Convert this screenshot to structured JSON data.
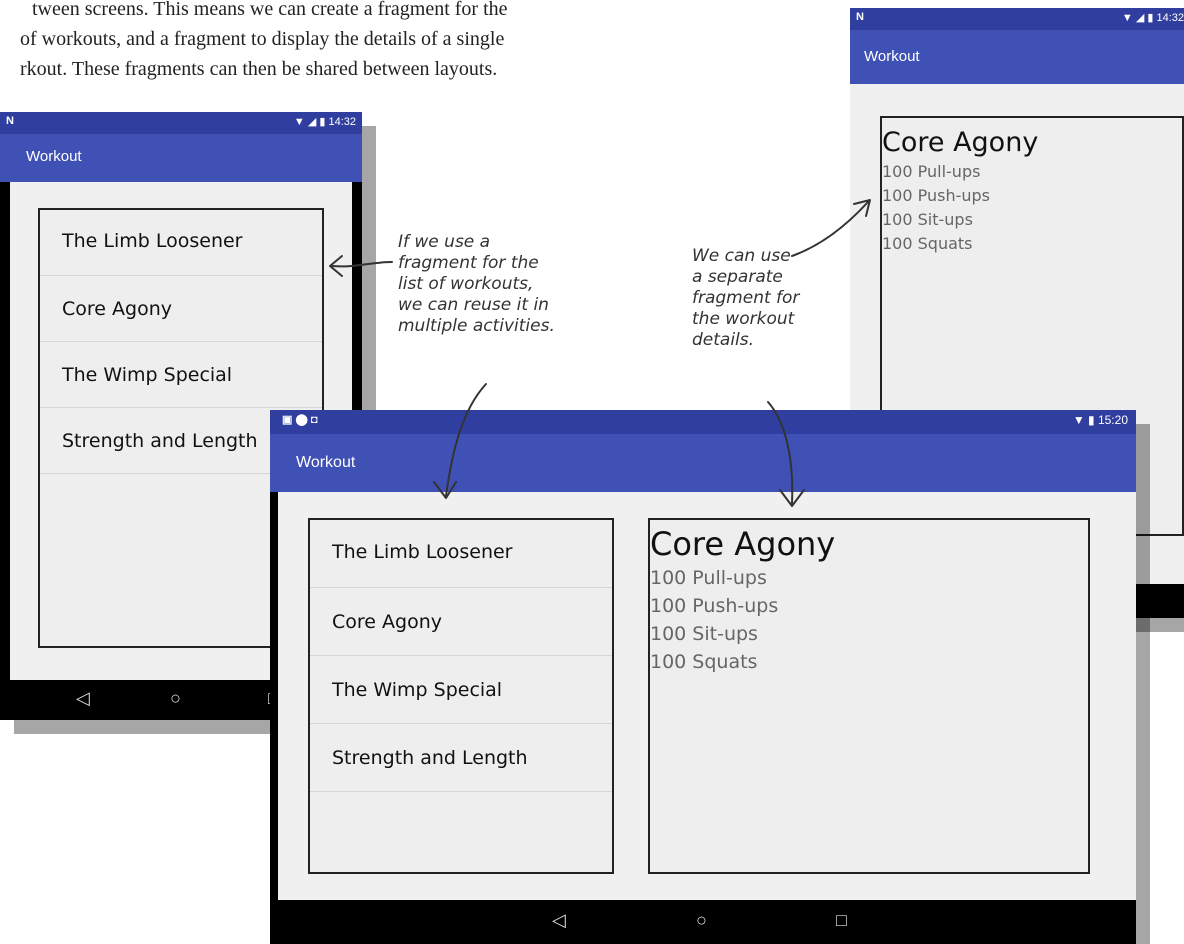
{
  "intro": {
    "line1": "tween screens. This means we can create a fragment for the",
    "line2": "of workouts, and a fragment to display the details of a single",
    "line3": "rkout. These fragments can then be shared between layouts."
  },
  "phone_left": {
    "status_left": "N",
    "status_right": "▼ ◢ ▮ 14:32",
    "app_title": "Workout",
    "workouts": [
      "The Limb Loosener",
      "Core Agony",
      "The Wimp Special",
      "Strength and Length"
    ],
    "nav": {
      "back": "◁",
      "home": "○",
      "recent": "□"
    }
  },
  "phone_right": {
    "status_left": "N",
    "status_right": "▼ ◢ ▮ 14:32",
    "app_title": "Workout",
    "detail_title": "Core Agony",
    "detail_lines": [
      "100 Pull-ups",
      "100 Push-ups",
      "100 Sit-ups",
      "100 Squats"
    ]
  },
  "tablet": {
    "status_left": "▣ ⬤ ◘",
    "status_right": "▼ ▮ 15:20",
    "app_title": "Workout",
    "workouts": [
      "The Limb Loosener",
      "Core Agony",
      "The Wimp Special",
      "Strength and Length"
    ],
    "detail_title": "Core Agony",
    "detail_lines": [
      "100 Pull-ups",
      "100 Push-ups",
      "100 Sit-ups",
      "100 Squats"
    ],
    "nav": {
      "back": "◁",
      "home": "○",
      "recent": "□"
    }
  },
  "annotations": {
    "list_note": [
      "If we use a",
      "fragment for the",
      "list of workouts,",
      "we can reuse it in",
      "multiple activities."
    ],
    "detail_note": [
      "We can use",
      "a separate",
      "fragment for",
      "the workout",
      "details."
    ]
  }
}
